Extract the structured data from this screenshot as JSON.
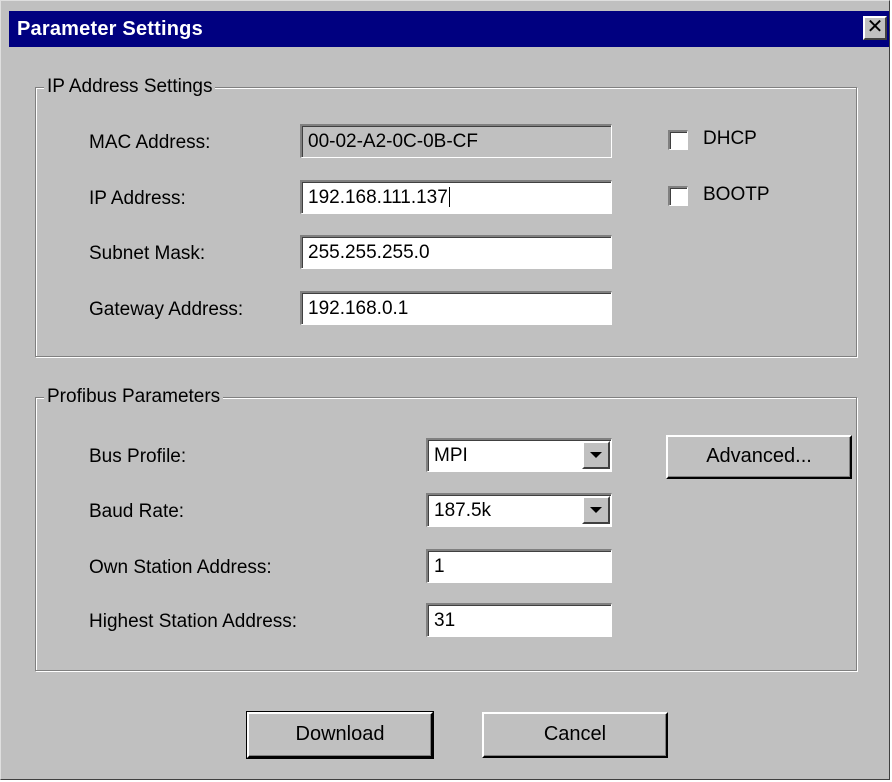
{
  "window": {
    "title": "Parameter Settings",
    "close_glyph": "✕"
  },
  "ip_group": {
    "legend": "IP Address Settings",
    "mac_label": "MAC Address:",
    "mac_value": "00-02-A2-0C-0B-CF",
    "ip_label": "IP Address:",
    "ip_value": "192.168.111.137",
    "subnet_label": "Subnet Mask:",
    "subnet_value": "255.255.255.0",
    "gateway_label": "Gateway Address:",
    "gateway_value": "192.168.0.1",
    "dhcp_label": "DHCP",
    "dhcp_checked": false,
    "bootp_label": "BOOTP",
    "bootp_checked": false
  },
  "profibus_group": {
    "legend": "Profibus Parameters",
    "bus_profile_label": "Bus Profile:",
    "bus_profile_value": "MPI",
    "baud_rate_label": "Baud Rate:",
    "baud_rate_value": "187.5k",
    "own_station_label": "Own Station Address:",
    "own_station_value": "1",
    "highest_station_label": "Highest Station Address:",
    "highest_station_value": "31",
    "advanced_label": "Advanced..."
  },
  "footer": {
    "download_label": "Download",
    "cancel_label": "Cancel"
  },
  "colors": {
    "titlebar": "#000080",
    "face": "#c0c0c0"
  }
}
